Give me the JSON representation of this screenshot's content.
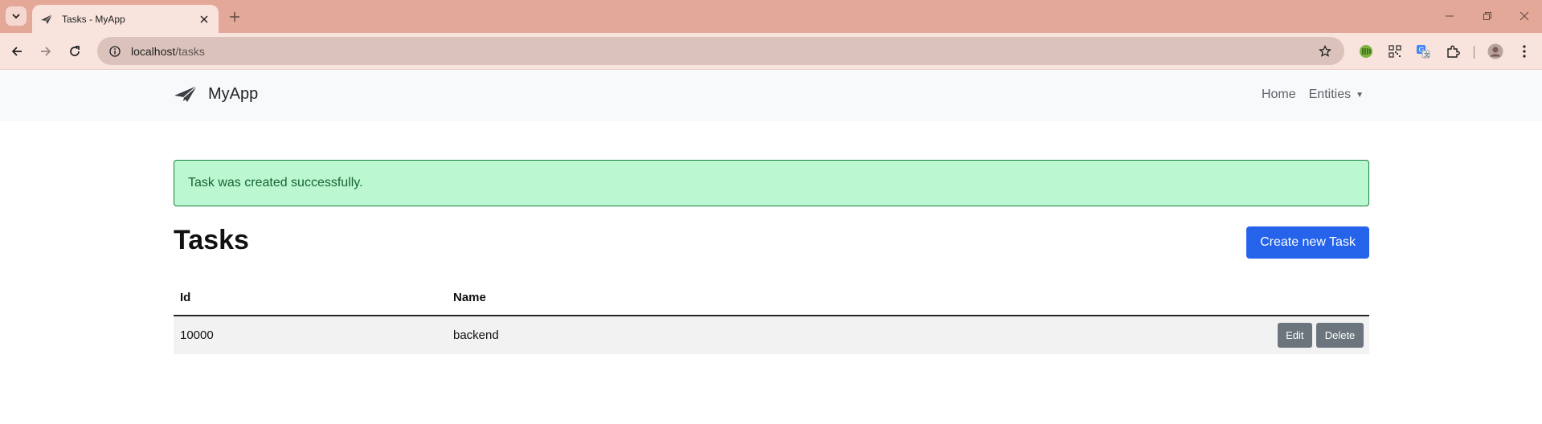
{
  "browser": {
    "tab_title": "Tasks - MyApp",
    "url_host": "localhost",
    "url_path": "/tasks",
    "colors": {
      "tabstrip": "#e3a897",
      "toolbar": "#f8e3dd",
      "omnibox": "#dbc3bb"
    }
  },
  "app": {
    "brand": "MyApp",
    "nav": {
      "home": "Home",
      "entities": "Entities"
    }
  },
  "alert": {
    "text": "Task was created successfully."
  },
  "main": {
    "title": "Tasks",
    "create_button": "Create new Task",
    "table": {
      "headers": [
        "Id",
        "Name"
      ],
      "rows": [
        {
          "id": "10000",
          "name": "backend",
          "edit": "Edit",
          "delete": "Delete"
        }
      ]
    }
  },
  "icons": {
    "tab_search": "chevron-down-icon",
    "favicon": "paper-plane-icon",
    "tab_close": "close-icon",
    "new_tab": "plus-icon",
    "back": "arrow-left-icon",
    "forward": "arrow-right-icon",
    "reload": "reload-icon",
    "site_info": "info-icon",
    "bookmark": "star-icon",
    "extensions": "puzzle-icon",
    "menu": "kebab-menu-icon"
  },
  "colors": {
    "primary": "#2563eb",
    "secondary": "#6c757d",
    "alert_bg": "#bbf7d0",
    "alert_border": "#15803d"
  }
}
